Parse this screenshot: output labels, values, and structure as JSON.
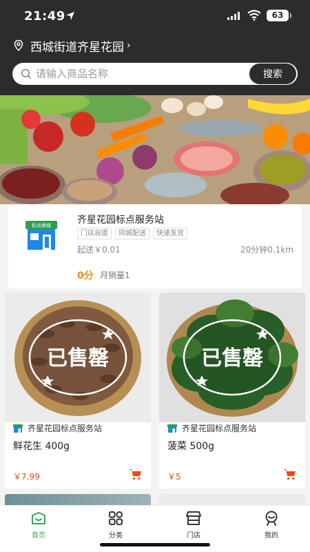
{
  "status_bar": {
    "time": "21:49",
    "battery": "63"
  },
  "location": {
    "text": "西城街道齐星花园"
  },
  "search": {
    "placeholder": "请输入商品名称",
    "button": "搜索"
  },
  "store": {
    "logo_text": "标点商城",
    "name": "齐星花园标点服务站",
    "tags": [
      "门店自提",
      "同城配送",
      "快速发货"
    ],
    "min_order": "起送￥0.01",
    "eta": "20分钟0.1km",
    "rating": "0分",
    "monthly_sales": "月销量1"
  },
  "products": [
    {
      "sold_out": "已售罄",
      "store": "齐星花园标点服务站",
      "name": "鲜花生 400g",
      "price": "￥7.99"
    },
    {
      "sold_out": "已售罄",
      "store": "齐星花园标点服务站",
      "name": "菠菜 500g",
      "price": "￥5"
    }
  ],
  "nav": [
    {
      "label": "首页",
      "active": true
    },
    {
      "label": "分类",
      "active": false
    },
    {
      "label": "门店",
      "active": false
    },
    {
      "label": "我的",
      "active": false
    }
  ],
  "colors": {
    "accent": "#3aa15b",
    "price": "#e8491d",
    "rating": "#f08c1e",
    "header": "#2c2c2c"
  }
}
